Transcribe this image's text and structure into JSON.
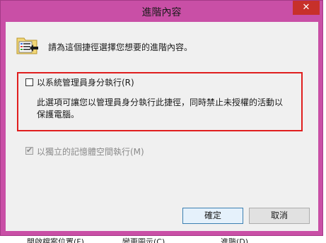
{
  "window": {
    "title": "進階內容",
    "close_glyph": "✕"
  },
  "intro_text": "請為這個捷徑選擇您想要的進階內容。",
  "run_as_admin": {
    "label": "以系統管理員身分執行(R)",
    "checked": false,
    "description": "此選項可讓您以管理員身分執行此捷徑，同時禁止未授權的活動以保護電腦。"
  },
  "separate_memory": {
    "label": "以獨立的記憶體空間執行(M)",
    "checked": true,
    "enabled": false,
    "check_glyph": "✔"
  },
  "buttons": {
    "ok": "確定",
    "cancel": "取消"
  },
  "background_strip": {
    "items": [
      "開啟檔案位置(F)",
      "變更圖示(C)",
      "進階(D)..."
    ]
  },
  "colors": {
    "window_frame": "#c94fa6",
    "close_button": "#c7302a",
    "highlight_box": "#e01e1e",
    "client_background": "#f0f0f0",
    "disabled_text": "#8a8a8a"
  },
  "icons": [
    "shortcut-properties-icon",
    "close-icon",
    "checkbox-icon",
    "checkmark-icon"
  ]
}
